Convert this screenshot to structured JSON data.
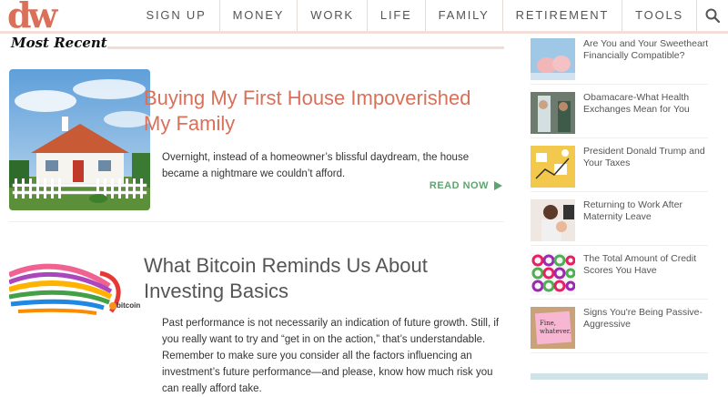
{
  "header": {
    "logo": "dw",
    "nav": [
      "SIGN UP",
      "MONEY",
      "WORK",
      "LIFE",
      "FAMILY",
      "RETIREMENT",
      "TOOLS"
    ],
    "search_icon": "search-icon"
  },
  "main": {
    "section_title": "Most Recent",
    "articles": [
      {
        "title": "Buying My First House Impoverished My Family",
        "excerpt": "Overnight, instead of a homeowner’s blissful daydream, the house became a nightmare we couldn’t afford.",
        "read_more": "READ NOW",
        "thumb_icon": "house-photo"
      },
      {
        "title": "What Bitcoin Reminds Us About Investing Basics",
        "excerpt": "Past performance is not necessarily an indication of future growth. Still, if you really want to try and “get in on the action,” that’s understandable. Remember to make sure you consider all the factors influencing an investment’s future performance—and please, know how much risk you can really afford take.",
        "thumb_icon": "bitcoin-illustration",
        "thumb_caption": "bitcoin"
      }
    ]
  },
  "sidebar": {
    "items": [
      {
        "title": "Are You and Your Sweetheart Financially Compatible?",
        "icon": "piggy-banks-photo"
      },
      {
        "title": "Obamacare-What Health Exchanges Mean for You",
        "icon": "doctor-photo"
      },
      {
        "title": "President Donald Trump and Your Taxes",
        "icon": "taxes-illustration"
      },
      {
        "title": "Returning to Work After Maternity Leave",
        "icon": "mother-baby-photo"
      },
      {
        "title": "The Total Amount of Credit Scores You Have",
        "icon": "credit-score-dials"
      },
      {
        "title": "Signs You're Being Passive-Aggressive",
        "icon": "sticky-note-photo",
        "note_text": "Fine, whatever."
      }
    ]
  },
  "colors": {
    "accent": "#d9705a",
    "read_more": "#5fa46f",
    "rule": "#f4dcd5"
  }
}
